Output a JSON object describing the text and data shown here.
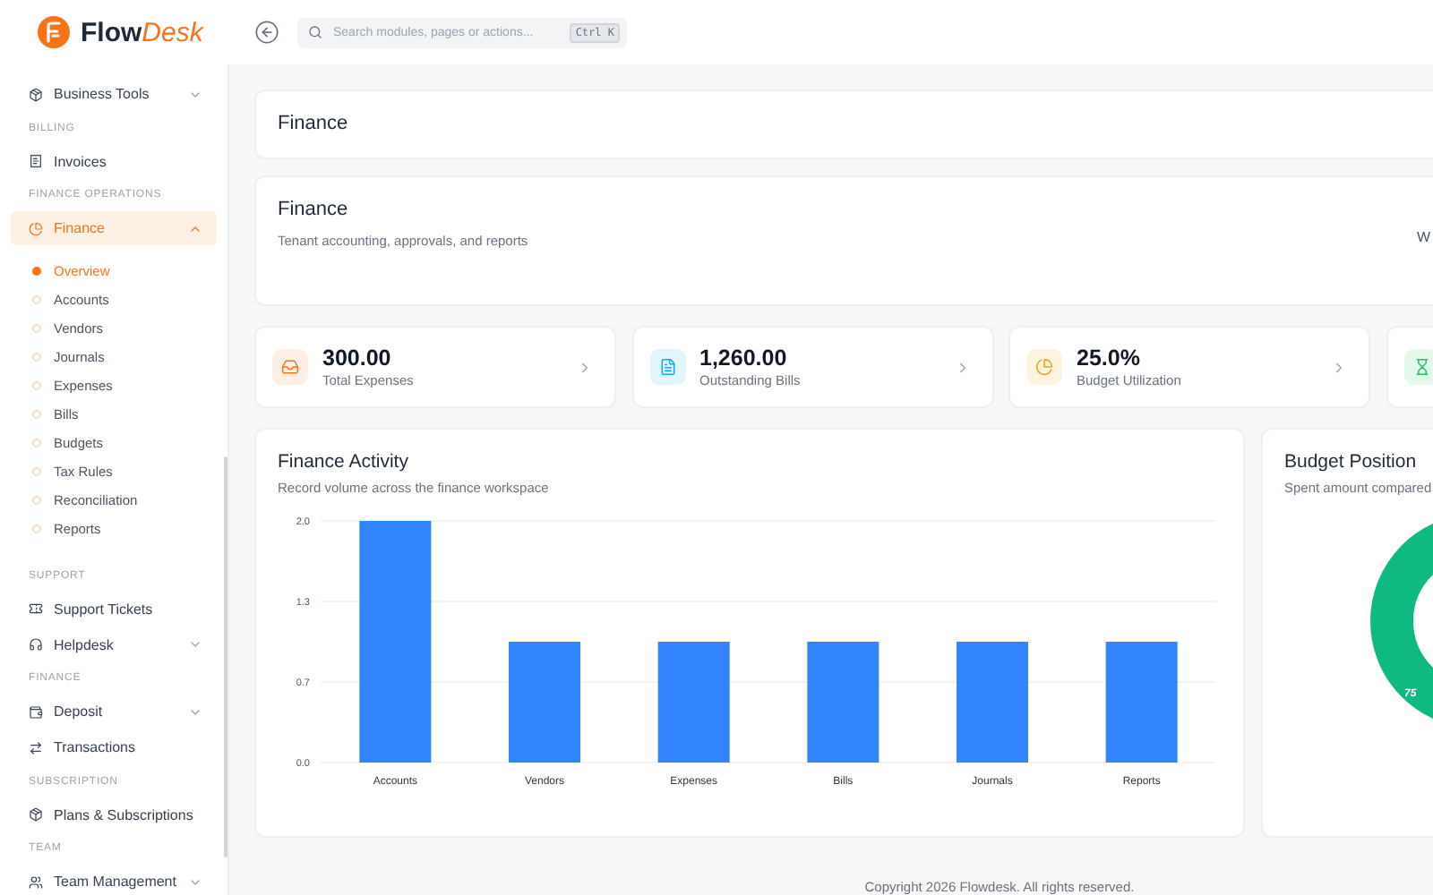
{
  "header": {
    "logo": {
      "name": "Flow",
      "accent": "Desk"
    },
    "search": {
      "placeholder": "Search modules, pages or actions...",
      "shortcut": "Ctrl K"
    }
  },
  "sidebar": {
    "sections": [
      {
        "items": [
          {
            "label": "Business Tools",
            "expanded": false,
            "selected": false
          }
        ]
      },
      {
        "label": "BILLING",
        "items": [
          {
            "label": "Invoices",
            "selected": false
          }
        ]
      },
      {
        "label": "FINANCE OPERATIONS",
        "items": [
          {
            "label": "Finance",
            "expanded": true,
            "selected": true,
            "children": [
              {
                "label": "Overview",
                "selected": true
              },
              {
                "label": "Accounts",
                "selected": false
              },
              {
                "label": "Vendors",
                "selected": false
              },
              {
                "label": "Journals",
                "selected": false
              },
              {
                "label": "Expenses",
                "selected": false
              },
              {
                "label": "Bills",
                "selected": false
              },
              {
                "label": "Budgets",
                "selected": false
              },
              {
                "label": "Tax Rules",
                "selected": false
              },
              {
                "label": "Reconciliation",
                "selected": false
              },
              {
                "label": "Reports",
                "selected": false
              }
            ]
          }
        ]
      },
      {
        "label": "SUPPORT",
        "items": [
          {
            "label": "Support Tickets",
            "selected": false
          },
          {
            "label": "Helpdesk",
            "expanded": false,
            "selected": false
          }
        ]
      },
      {
        "label": "FINANCE",
        "items": [
          {
            "label": "Deposit",
            "expanded": false,
            "selected": false
          },
          {
            "label": "Transactions",
            "selected": false
          }
        ]
      },
      {
        "label": "SUBSCRIPTION",
        "items": [
          {
            "label": "Plans & Subscriptions",
            "selected": false
          }
        ]
      },
      {
        "label": "TEAM",
        "items": [
          {
            "label": "Team Management",
            "expanded": false,
            "selected": false
          }
        ]
      }
    ]
  },
  "page_header": {
    "title": "Finance"
  },
  "intro": {
    "title": "Finance",
    "subtitle": "Tenant accounting, approvals, and reports",
    "aside": "W"
  },
  "stats": [
    {
      "value": "300.00",
      "label": "Total Expenses",
      "color": "#f97316"
    },
    {
      "value": "1,260.00",
      "label": "Outstanding Bills",
      "color": "#0ea5e9"
    },
    {
      "value": "25.0%",
      "label": "Budget Utilization",
      "color": "#f59e0b"
    },
    {
      "color": "#22c55e"
    }
  ],
  "activity": {
    "title": "Finance Activity",
    "subtitle": "Record volume across the finance workspace",
    "chart_data": {
      "type": "bar",
      "categories": [
        "Accounts",
        "Vendors",
        "Expenses",
        "Bills",
        "Journals",
        "Reports"
      ],
      "values": [
        2,
        1,
        1,
        1,
        1,
        1
      ],
      "ylim": [
        0,
        2
      ],
      "yticks": [
        {
          "value": 0,
          "label": "0.0"
        },
        {
          "value": 0.667,
          "label": "0.7"
        },
        {
          "value": 1.333,
          "label": "1.3"
        },
        {
          "value": 2,
          "label": "2.0"
        }
      ]
    }
  },
  "budget": {
    "title": "Budget Position",
    "subtitle": "Spent amount compared",
    "donut_label": "75"
  },
  "footer": "Copyright 2026 Flowdesk. All rights reserved."
}
